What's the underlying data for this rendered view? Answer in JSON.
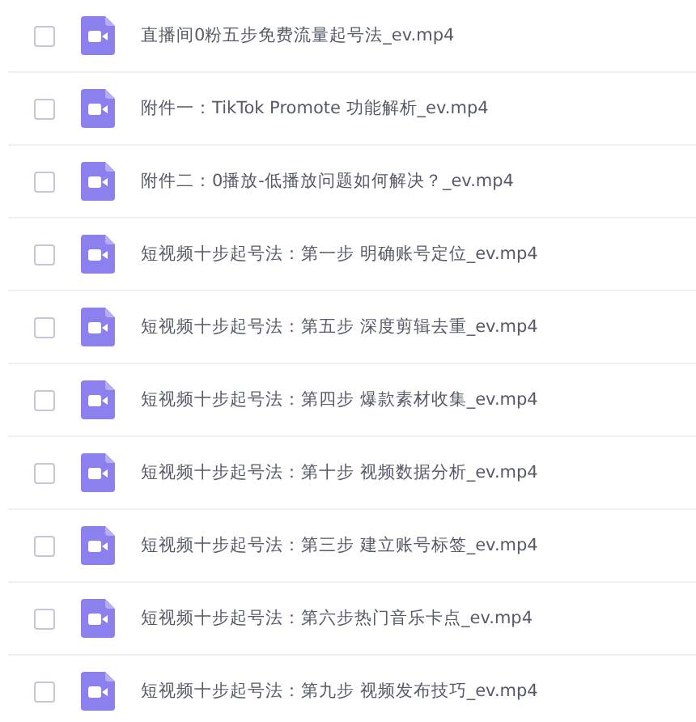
{
  "files": [
    {
      "name": "直播间0粉五步免费流量起号法_ev.mp4",
      "checked": false
    },
    {
      "name": "附件一：TikTok Promote 功能解析_ev.mp4",
      "checked": false
    },
    {
      "name": "附件二：0播放-低播放问题如何解决？_ev.mp4",
      "checked": false
    },
    {
      "name": "短视频十步起号法：第一步 明确账号定位_ev.mp4",
      "checked": false
    },
    {
      "name": "短视频十步起号法：第五步 深度剪辑去重_ev.mp4",
      "checked": false
    },
    {
      "name": "短视频十步起号法：第四步 爆款素材收集_ev.mp4",
      "checked": false
    },
    {
      "name": "短视频十步起号法：第十步 视频数据分析_ev.mp4",
      "checked": false
    },
    {
      "name": "短视频十步起号法：第三步 建立账号标签_ev.mp4",
      "checked": false
    },
    {
      "name": "短视频十步起号法：第六步热门音乐卡点_ev.mp4",
      "checked": false
    },
    {
      "name": "短视频十步起号法：第九步 视频发布技巧_ev.mp4",
      "checked": false
    }
  ]
}
